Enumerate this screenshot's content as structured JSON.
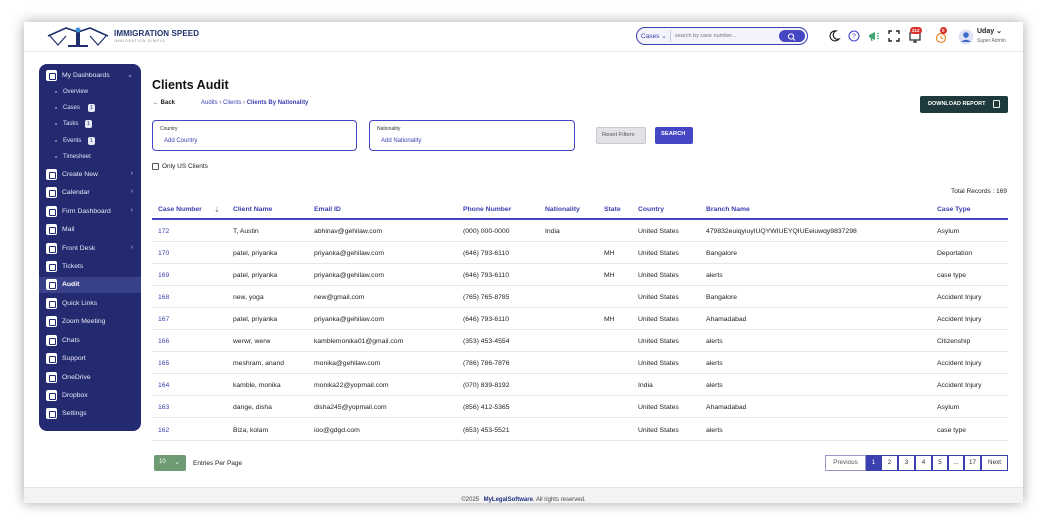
{
  "header": {
    "logo_text": "IMMIGRATION SPEED",
    "logo_subtext": "IMMIGRATION SIMPLE",
    "search_scope": "Cases",
    "search_placeholder": "search by case number...",
    "notification_badge": "212",
    "alert_badge": "0",
    "user_name": "Uday",
    "user_role": "Super Admin"
  },
  "sidebar": {
    "items": [
      {
        "label": "My Dashboards",
        "chevron": "⌄"
      },
      {
        "label": "Create New",
        "chevron": "›"
      },
      {
        "label": "Calendar",
        "chevron": "›"
      },
      {
        "label": "Firm Dashboard",
        "chevron": "›"
      },
      {
        "label": "Mail",
        "chevron": ""
      },
      {
        "label": "Front Desk",
        "chevron": "›"
      },
      {
        "label": "Tickets",
        "chevron": ""
      },
      {
        "label": "Audit",
        "chevron": ""
      },
      {
        "label": "Quick Links",
        "chevron": ""
      },
      {
        "label": "Zoom Meeting",
        "chevron": ""
      },
      {
        "label": "Chats",
        "chevron": ""
      },
      {
        "label": "Support",
        "chevron": ""
      },
      {
        "label": "OneDrive",
        "chevron": ""
      },
      {
        "label": "Dropbox",
        "chevron": ""
      },
      {
        "label": "Settings",
        "chevron": ""
      }
    ],
    "subitems": [
      {
        "label": "Overview",
        "count": ""
      },
      {
        "label": "Cases",
        "count": "1"
      },
      {
        "label": "Tasks",
        "count": "1"
      },
      {
        "label": "Events",
        "count": "1"
      },
      {
        "label": "Timesheet",
        "count": ""
      }
    ]
  },
  "page": {
    "title": "Clients Audit",
    "back_label": "Back",
    "breadcrumb_1": "Audits",
    "breadcrumb_2": "Clients",
    "breadcrumb_3": "Clients By Nationality",
    "download_label": "DOWNLOAD REPORT",
    "country_label": "Country",
    "country_value": "Add Country",
    "nationality_label": "Nationality",
    "nationality_value": "Add Nationality",
    "reset_label": "Reset Filters",
    "search_label": "SEARCH",
    "us_only_label": "Only US Clients",
    "total_records": "Total Records : 169"
  },
  "table": {
    "headers": [
      "Case Number",
      "Client Name",
      "Email ID",
      "Phone Number",
      "Nationality",
      "State",
      "Country",
      "Branch Name",
      "Case Type"
    ],
    "sort_icon": "⇣",
    "rows": [
      [
        "172",
        "T, Austin",
        "abhinav@gehilaw.com",
        "(000) 000-0000",
        "India",
        "",
        "United States",
        "479832euiqyiuyIUQYWIUEYQIUEeiuwqy9837298",
        "Asylum"
      ],
      [
        "170",
        "patel, priyanka",
        "priyanka@gehilaw.com",
        "(646) 793-6110",
        "",
        "MH",
        "United States",
        "Bangalore",
        "Deportation"
      ],
      [
        "169",
        "patel, priyanka",
        "priyanka@gehilaw.com",
        "(646) 793-6110",
        "",
        "MH",
        "United States",
        "alerts",
        "case type"
      ],
      [
        "168",
        "new, yoga",
        "new@gmail.com",
        "(765) 765-8785",
        "",
        "",
        "United States",
        "Bangalore",
        "Accident Injury"
      ],
      [
        "167",
        "patel, priyanka",
        "priyanka@gehilaw.com",
        "(646) 793-6110",
        "",
        "MH",
        "United States",
        "Ahamadabad",
        "Accident Injury"
      ],
      [
        "166",
        "werwr, werw",
        "kamblemonika01@gmail.com",
        "(353) 453-4554",
        "",
        "",
        "United States",
        "alerts",
        "Citizenship"
      ],
      [
        "165",
        "meshram, anand",
        "monika@gehilaw.com",
        "(786) 786-7876",
        "",
        "",
        "United States",
        "alerts",
        "Accident Injury"
      ],
      [
        "164",
        "kamble, monika",
        "monika22@yopmail.com",
        "(070) 839-8192",
        "",
        "",
        "India",
        "alerts",
        "Accident Injury"
      ],
      [
        "163",
        "dange, disha",
        "disha245@yopmail.com",
        "(856) 412-5365",
        "",
        "",
        "United States",
        "Ahamadabad",
        "Asylum"
      ],
      [
        "162",
        "Biza, kolam",
        "ioo@gdgd.com",
        "(653) 453-5521",
        "",
        "",
        "United States",
        "alerts",
        "case type"
      ]
    ]
  },
  "pagination": {
    "per_page_value": "10",
    "per_page_label": "Entries Per Page",
    "prev_label": "Previous",
    "pages": [
      "1",
      "2",
      "3",
      "4",
      "5",
      "...",
      "17"
    ],
    "next_label": "Next"
  },
  "footer": {
    "copyright": "©2025",
    "brand": "MyLegalSoftware",
    "rights": ". All rights reserved."
  },
  "colors": {
    "sidebar_bg": "#232a70",
    "primary": "#4446c4",
    "download_bg": "#1f3a3d"
  }
}
